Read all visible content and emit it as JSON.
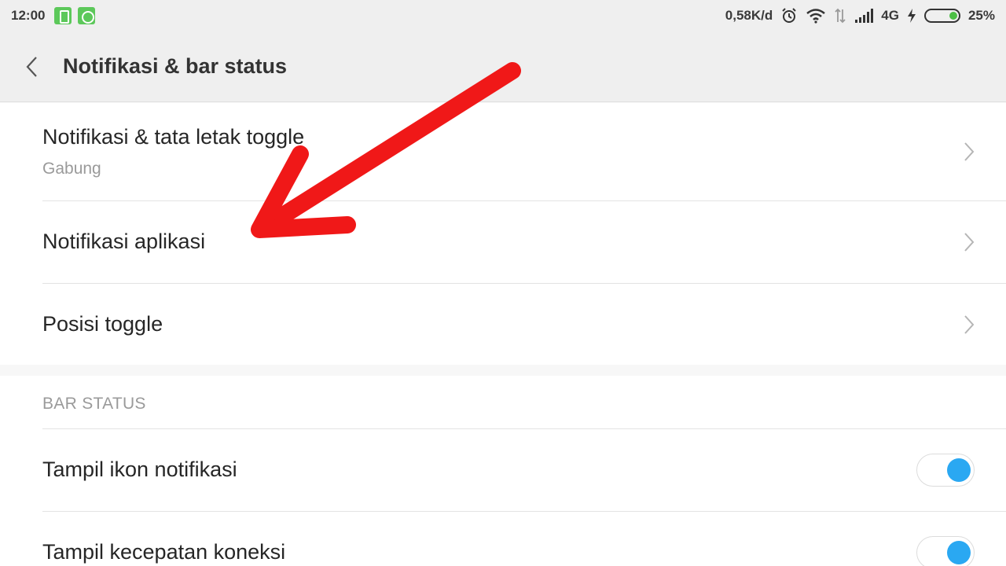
{
  "status_bar": {
    "time": "12:00",
    "network_speed": "0,58K/d",
    "network_type": "4G",
    "battery": "25%",
    "icons": [
      "phone-notification-icon",
      "chat-notification-icon",
      "alarm-icon",
      "wifi-icon",
      "data-transfer-icon",
      "signal-icon",
      "charging-icon",
      "battery-icon"
    ],
    "notification_color": "#5cc85a"
  },
  "header": {
    "title": "Notifikasi & bar status",
    "back_icon": "chevron-left-icon"
  },
  "settings": {
    "items": [
      {
        "label": "Notifikasi & tata letak toggle",
        "subtitle": "Gabung"
      },
      {
        "label": "Notifikasi aplikasi"
      },
      {
        "label": "Posisi toggle"
      }
    ]
  },
  "bar_status": {
    "header": "BAR STATUS",
    "toggles": [
      {
        "label": "Tampil ikon notifikasi",
        "on": true
      },
      {
        "label": "Tampil kecepatan koneksi",
        "on": true
      }
    ],
    "accent_color": "#2aa8f2"
  },
  "annotation": {
    "arrow_color": "#f01818"
  }
}
